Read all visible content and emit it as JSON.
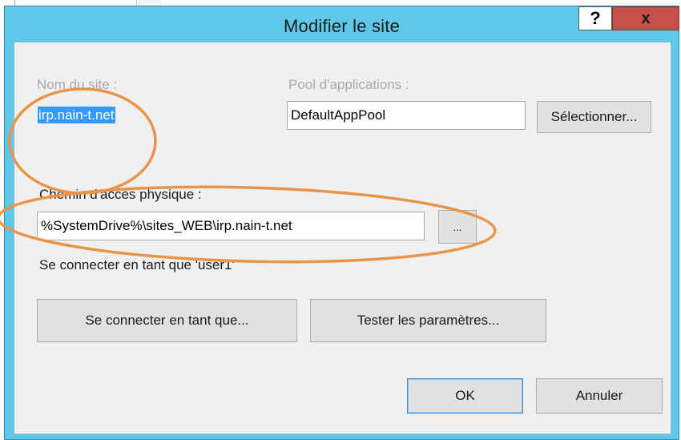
{
  "dialog": {
    "title": "Modifier le site",
    "help_label": "?",
    "close_label": "x"
  },
  "site": {
    "name_label": "Nom du site :",
    "name_value": "irp.nain-t.net",
    "pool_label": "Pool d'applications :",
    "pool_value": "DefaultAppPool",
    "select_button": "Sélectionner..."
  },
  "path": {
    "label": "Chemin d'accès physique :",
    "value": "%SystemDrive%\\sites_WEB\\irp.nain-t.net",
    "browse_button": "..."
  },
  "connect": {
    "status": "Se connecter en tant que 'user1'",
    "connect_button": "Se connecter en tant que...",
    "test_button": "Tester les paramètres..."
  },
  "footer": {
    "ok_button": "OK",
    "cancel_button": "Annuler"
  },
  "colors": {
    "titlebar": "#5fc8e8",
    "close": "#c7504a",
    "selection": "#3399ff",
    "annotation": "#e8944a"
  },
  "icons": [
    "help-icon",
    "close-icon"
  ]
}
